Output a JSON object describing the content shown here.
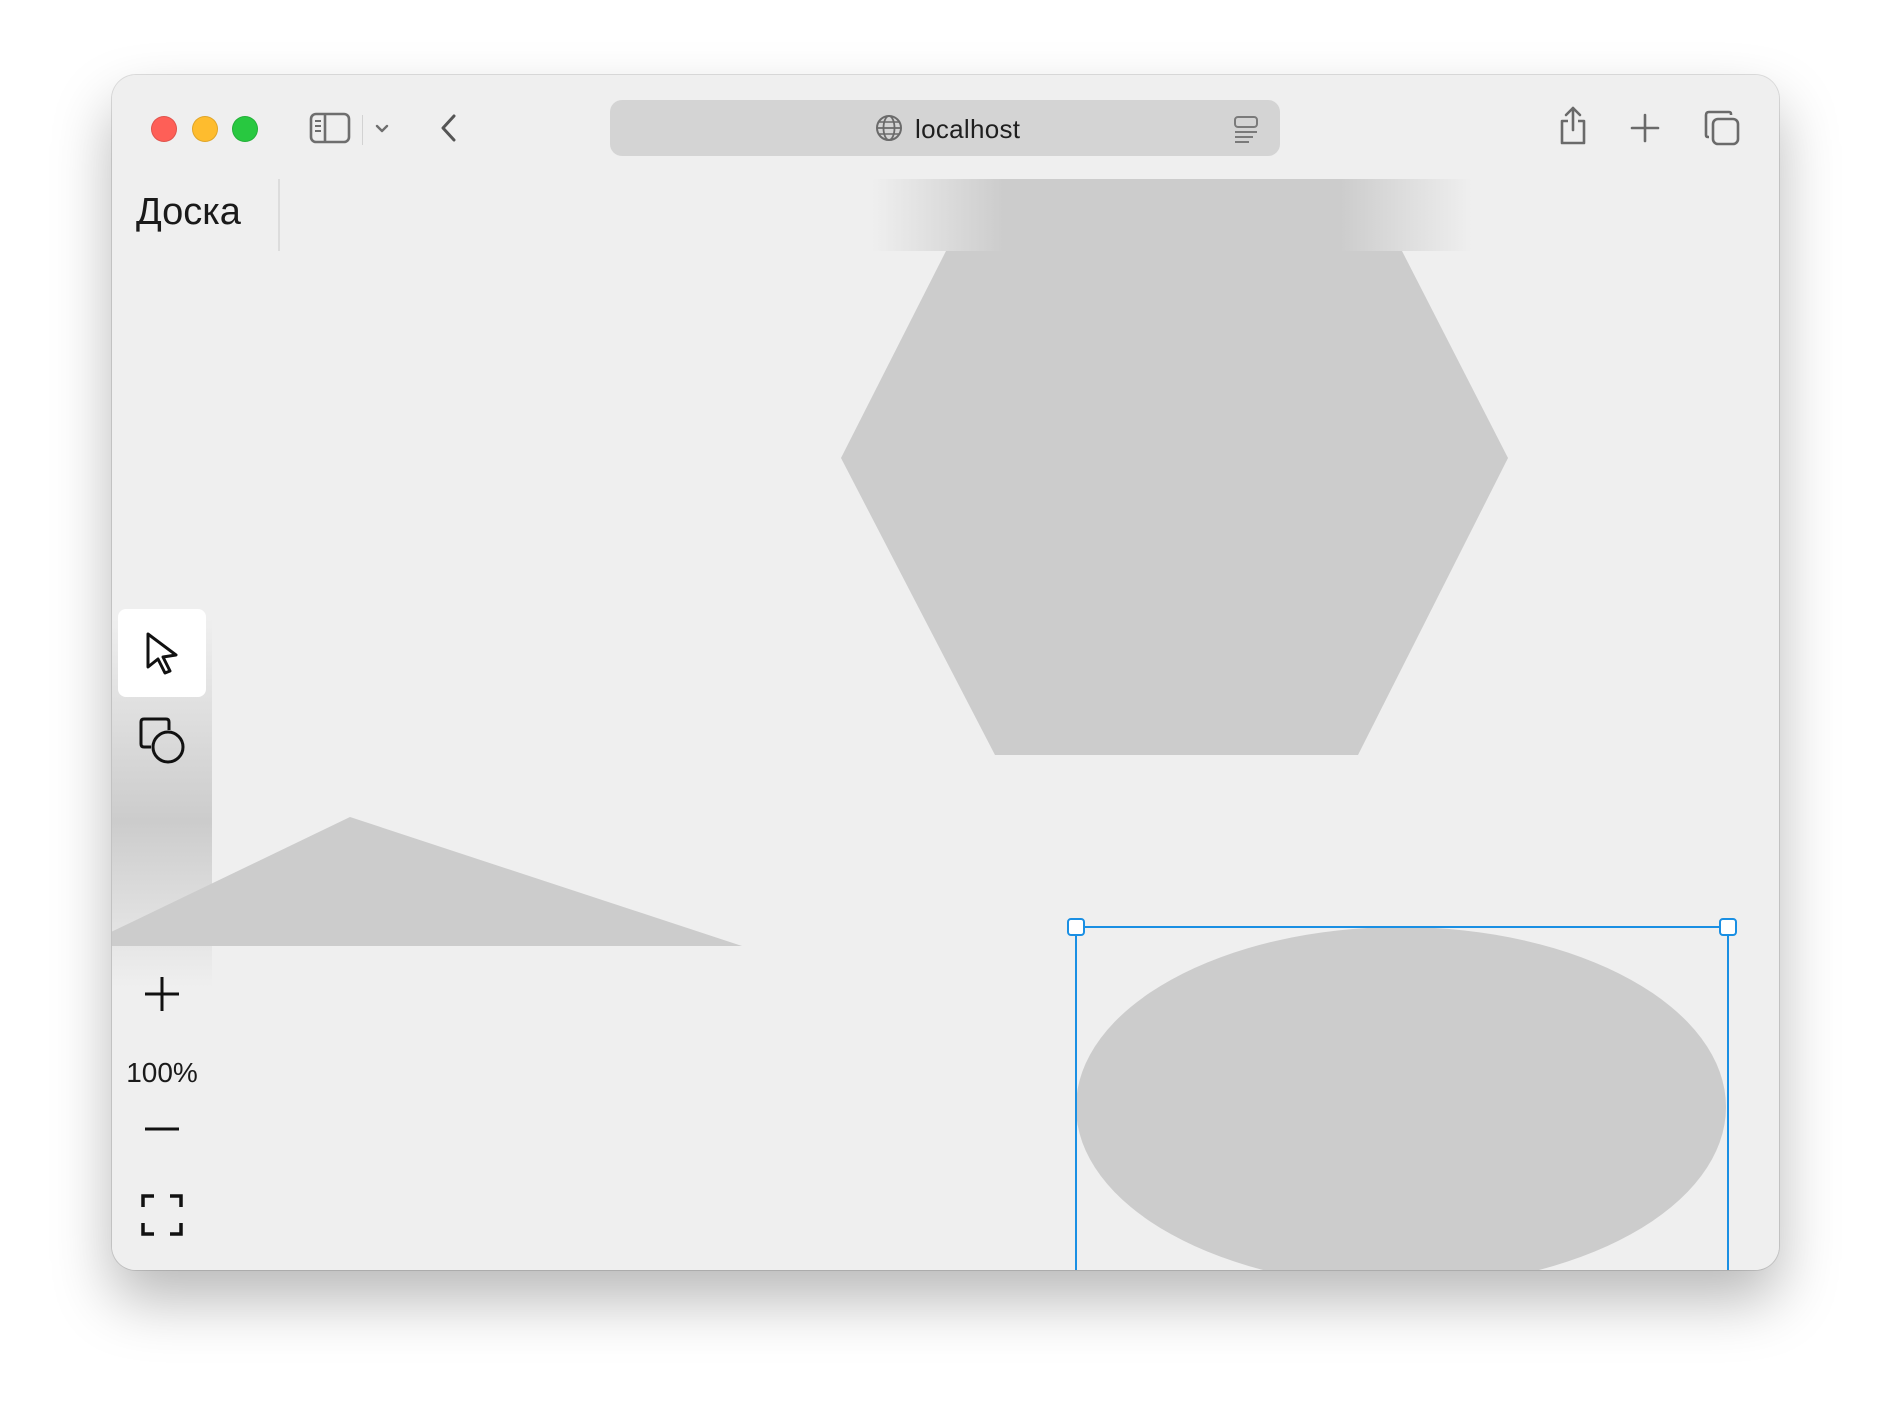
{
  "browser": {
    "url": "localhost",
    "icons": {
      "sidebar": "sidebar-icon",
      "chevron": "chevron-down-icon",
      "back": "back-icon",
      "globe": "globe-icon",
      "reader": "reader-icon",
      "share": "share-icon",
      "new_tab": "plus-icon",
      "tabs": "tabs-overview-icon"
    }
  },
  "app": {
    "board_title": "Доска",
    "zoom_level": "100%",
    "tools": [
      {
        "name": "select",
        "icon": "cursor-icon",
        "active": true
      },
      {
        "name": "shapes",
        "icon": "shapes-icon",
        "active": false
      }
    ],
    "zoom_controls": {
      "zoom_in_icon": "plus-icon",
      "zoom_out_icon": "minus-icon",
      "fit_icon": "fit-screen-icon"
    }
  },
  "canvas": {
    "shapes": [
      {
        "kind": "triangle",
        "selected": false
      },
      {
        "kind": "hexagon",
        "selected": false
      },
      {
        "kind": "ellipse",
        "selected": true
      }
    ],
    "colors": {
      "shape_fill": "#cccccc",
      "selection": "#1a8fe3",
      "background": "#efefef"
    }
  }
}
